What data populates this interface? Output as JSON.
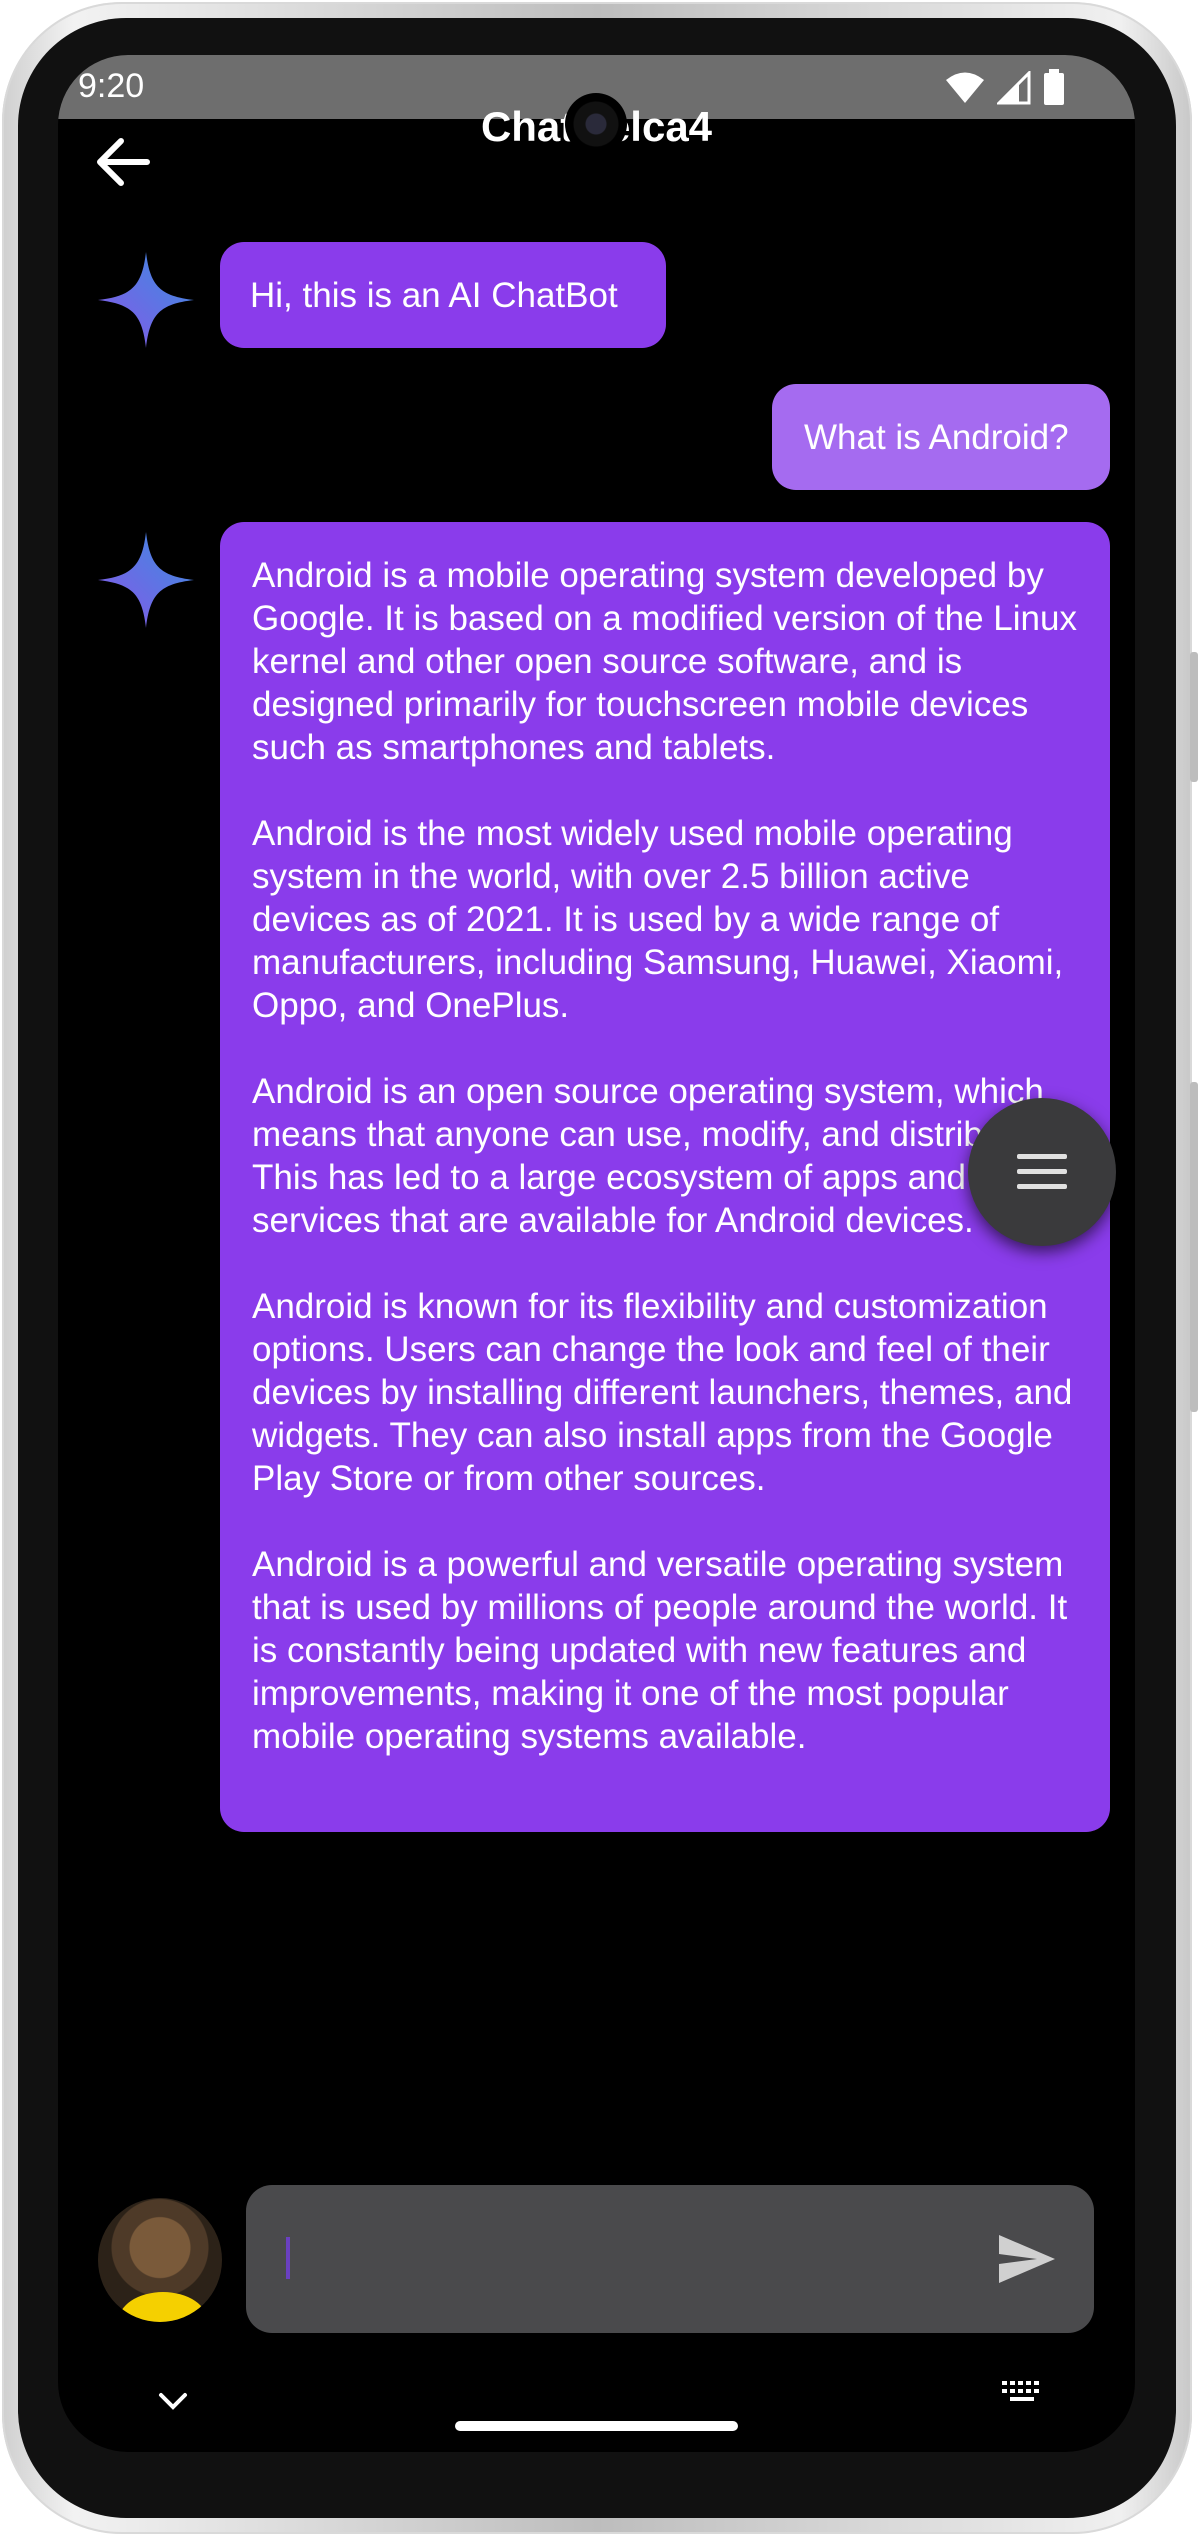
{
  "status_bar": {
    "time": "9:20",
    "icons": [
      "wifi-icon",
      "signal-icon",
      "battery-icon"
    ]
  },
  "app_bar": {
    "title": "ChatGelca4",
    "back_icon": "arrow-back-icon"
  },
  "messages": [
    {
      "sender": "bot",
      "text": "Hi, this is an AI ChatBot"
    },
    {
      "sender": "user",
      "text": "What is Android?"
    },
    {
      "sender": "bot",
      "paragraphs": [
        "Android is a mobile operating system developed by Google. It is based on a modified version of the Linux kernel and other open source software, and is designed primarily for touchscreen mobile devices such as smartphones and tablets.",
        "Android is the most widely used mobile operating system in the world, with over 2.5 billion active devices as of 2021. It is used by a wide range of manufacturers, including Samsung, Huawei, Xiaomi, Oppo, and OnePlus.",
        "Android is an open source operating system, which means that anyone can use, modify, and distribute it. This has led to a large ecosystem of apps and services that are available for Android devices.",
        "Android is known for its flexibility and customization options. Users can change the look and feel of their devices by installing different launchers, themes, and widgets. They can also install apps from the Google Play Store or from other sources.",
        "Android is a powerful and versatile operating system that is used by millions of people around the world. It is constantly being updated with new features and improvements, making it one of the most popular mobile operating systems available."
      ]
    }
  ],
  "fab": {
    "icon": "menu-icon"
  },
  "composer": {
    "value": "",
    "placeholder": "",
    "send_icon": "send-icon"
  },
  "nav": {
    "hide_keyboard_icon": "chevron-down-icon",
    "keyboard_icon": "keyboard-icon"
  },
  "colors": {
    "bot_bubble": "#8a3ceb",
    "user_bubble": "#a56bf0",
    "background": "#000000",
    "input_box": "#4a4a4c"
  }
}
